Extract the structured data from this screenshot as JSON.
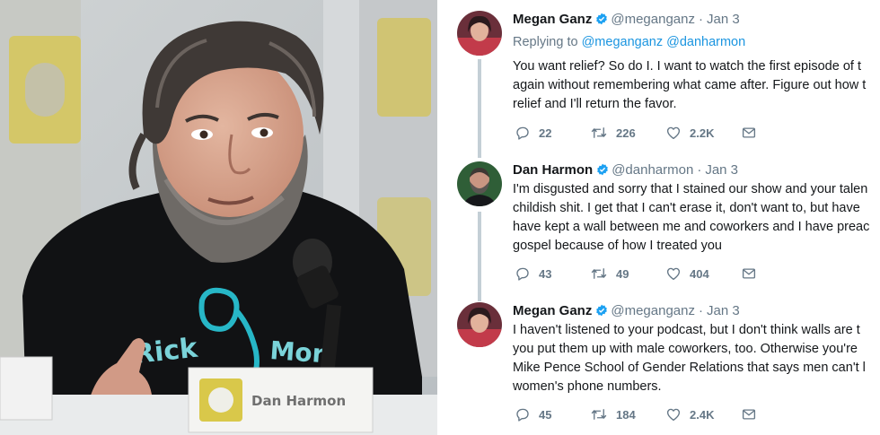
{
  "photo": {
    "nameplate_text": "Dan Harmon",
    "shirt_text": "Rick and Morty"
  },
  "tweets": [
    {
      "name": "Megan Ganz",
      "handle": "@meganganz",
      "date": "Jan 3",
      "replying_label": "Replying to",
      "replying_to": [
        "@meganganz",
        "@danharmon"
      ],
      "lines": [
        "You want relief? So do I. I want to watch the first episode of t",
        "again without remembering what came after. Figure out how t",
        "relief and I'll return the favor."
      ],
      "replies": "22",
      "retweets": "226",
      "likes": "2.2K"
    },
    {
      "name": "Dan Harmon",
      "handle": "@danharmon",
      "date": "Jan 3",
      "lines": [
        "I'm disgusted and sorry that I stained our show and your talen",
        "childish shit. I get that I can't erase it, don't want to, but have",
        "have kept a wall between me and coworkers and I have preac",
        "gospel because of how I treated you"
      ],
      "replies": "43",
      "retweets": "49",
      "likes": "404"
    },
    {
      "name": "Megan Ganz",
      "handle": "@meganganz",
      "date": "Jan 3",
      "lines": [
        "I haven't listened to your podcast, but I don't think walls are t",
        "you put them up with male coworkers, too. Otherwise you're",
        "Mike Pence School of Gender Relations that says men can't l",
        "women's phone numbers."
      ],
      "replies": "45",
      "retweets": "184",
      "likes": "2.4K"
    }
  ],
  "colors": {
    "text": "#14171a",
    "secondary": "#657786",
    "link": "#1b95e0",
    "verified": "#1da1f2",
    "thread_line": "#c4cfd6"
  }
}
